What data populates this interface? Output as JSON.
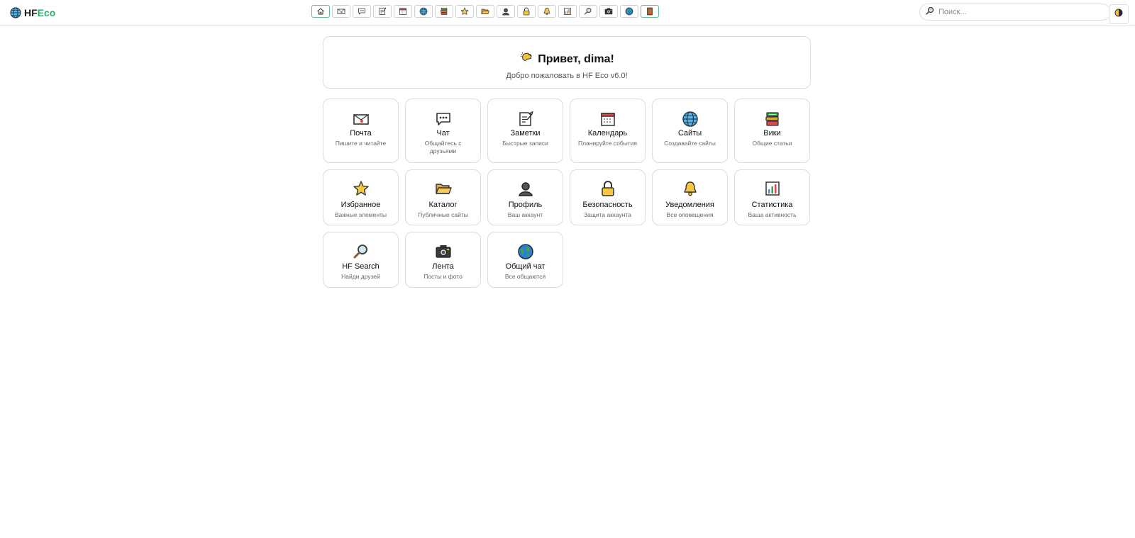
{
  "header": {
    "logo_hf": "HF",
    "logo_eco": "Eco",
    "logo_icon": "globe-icon",
    "nav": [
      {
        "icon": "home-icon",
        "active": true
      },
      {
        "icon": "mail-icon"
      },
      {
        "icon": "chat-icon"
      },
      {
        "icon": "notes-icon"
      },
      {
        "icon": "calendar-icon"
      },
      {
        "icon": "globe-icon"
      },
      {
        "icon": "books-icon"
      },
      {
        "icon": "star-icon"
      },
      {
        "icon": "folder-icon"
      },
      {
        "icon": "profile-icon"
      },
      {
        "icon": "lock-icon"
      },
      {
        "icon": "bell-icon"
      },
      {
        "icon": "chart-icon"
      },
      {
        "icon": "magnifier-icon"
      },
      {
        "icon": "camera-icon"
      },
      {
        "icon": "earth-icon"
      },
      {
        "icon": "exit-door-icon",
        "active": true
      }
    ],
    "search_placeholder": "Поиск...",
    "theme_icon": "theme-toggle-icon"
  },
  "welcome": {
    "greeting": "Привет, dima!",
    "subtitle": "Добро пожаловать в HF Eco v6.0!",
    "icon": "waving-hand-icon"
  },
  "cards": [
    {
      "id": "mail",
      "title": "Почта",
      "desc": "Пишите и читайте",
      "icon": "mail-icon"
    },
    {
      "id": "chat",
      "title": "Чат",
      "desc": "Общайтесь с друзьями",
      "icon": "chat-icon"
    },
    {
      "id": "notes",
      "title": "Заметки",
      "desc": "Быстрые записи",
      "icon": "notes-icon"
    },
    {
      "id": "calendar",
      "title": "Календарь",
      "desc": "Планируйте события",
      "icon": "calendar-icon"
    },
    {
      "id": "sites",
      "title": "Сайты",
      "desc": "Создавайте сайты",
      "icon": "globe-icon"
    },
    {
      "id": "wiki",
      "title": "Вики",
      "desc": "Общие статьи",
      "icon": "books-icon"
    },
    {
      "id": "favorites",
      "title": "Избранное",
      "desc": "Важные элементы",
      "icon": "star-icon"
    },
    {
      "id": "catalog",
      "title": "Каталог",
      "desc": "Публичные сайты",
      "icon": "folder-icon"
    },
    {
      "id": "profile",
      "title": "Профиль",
      "desc": "Ваш аккаунт",
      "icon": "profile-icon"
    },
    {
      "id": "security",
      "title": "Безопасность",
      "desc": "Защита аккаунта",
      "icon": "lock-icon"
    },
    {
      "id": "notifications",
      "title": "Уведомления",
      "desc": "Все оповещения",
      "icon": "bell-icon"
    },
    {
      "id": "stats",
      "title": "Статистика",
      "desc": "Ваша активность",
      "icon": "chart-icon"
    },
    {
      "id": "hf-search",
      "title": "HF Search",
      "desc": "Найди друзей",
      "icon": "magnifier-icon"
    },
    {
      "id": "feed",
      "title": "Лента",
      "desc": "Посты и фото",
      "icon": "camera-icon"
    },
    {
      "id": "general-chat",
      "title": "Общий чат",
      "desc": "Все общаются",
      "icon": "earth-icon"
    }
  ]
}
